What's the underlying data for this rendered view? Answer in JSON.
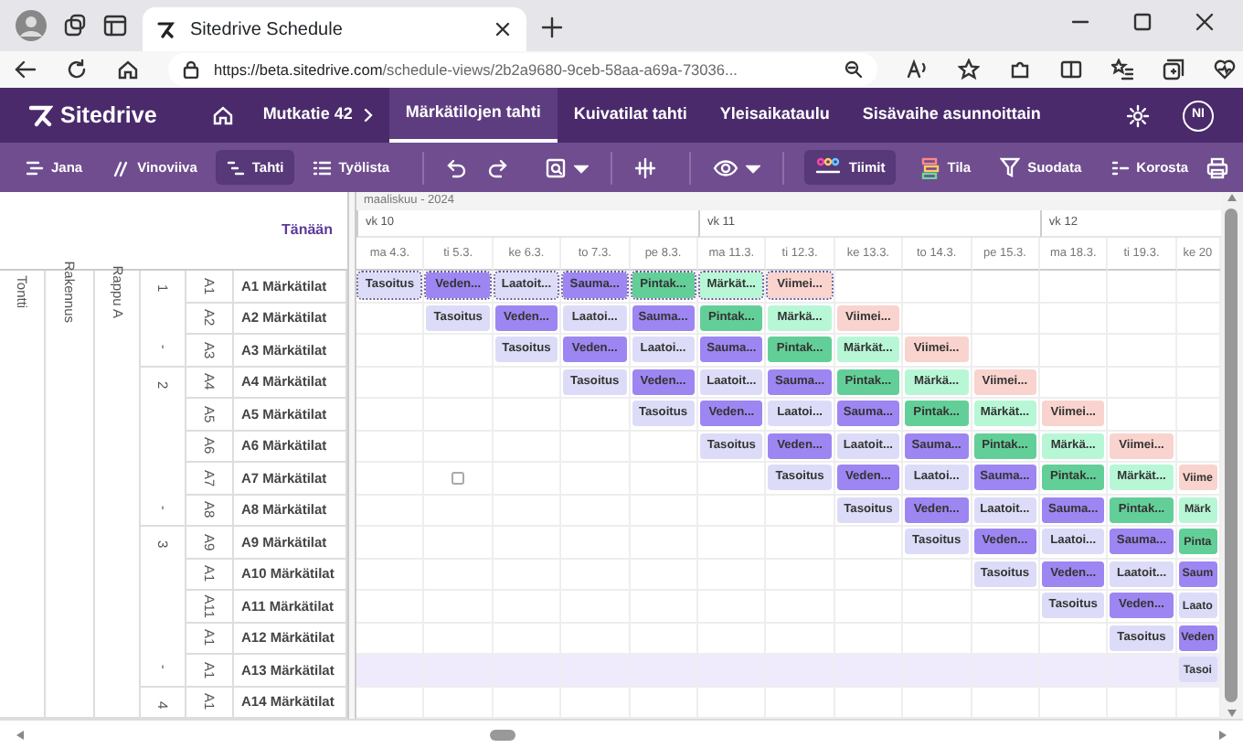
{
  "browser": {
    "tab_title": "Sitedrive Schedule",
    "url_host": "https://beta.sitedrive.com",
    "url_path": "/schedule-views/2b2a9680-9ceb-58aa-a69a-73036..."
  },
  "app": {
    "logo": "Sitedrive",
    "project": "Mutkatie 42",
    "avatar": "NI",
    "views": [
      {
        "label": "Märkätilojen tahti",
        "selected": true
      },
      {
        "label": "Kuivatilat tahti",
        "selected": false
      },
      {
        "label": "Yleisaikataulu",
        "selected": false
      },
      {
        "label": "Sisävaihe asunnoittain",
        "selected": false
      }
    ]
  },
  "toolbar": {
    "modes": [
      {
        "label": "Jana",
        "kind": "jana",
        "selected": false
      },
      {
        "label": "Vinoviiva",
        "kind": "vino",
        "selected": false
      },
      {
        "label": "Tahti",
        "kind": "tahti",
        "selected": true
      },
      {
        "label": "Työlista",
        "kind": "list",
        "selected": false
      }
    ],
    "teams": {
      "label": "Tiimit",
      "selected": true
    },
    "state": {
      "label": "Tila"
    },
    "filter": {
      "label": "Suodata"
    },
    "highlight": {
      "label": "Korosta"
    }
  },
  "schedule": {
    "today": "Tänään",
    "month": "maaliskuu - 2024",
    "weeks": [
      {
        "label": "vk 10",
        "days": [
          {
            "label": "ma 4.3."
          },
          {
            "label": "ti 5.3."
          },
          {
            "label": "ke 6.3."
          },
          {
            "label": "to 7.3."
          },
          {
            "label": "pe 8.3."
          }
        ]
      },
      {
        "label": "vk 11",
        "days": [
          {
            "label": "ma 11.3."
          },
          {
            "label": "ti 12.3."
          },
          {
            "label": "ke 13.3."
          },
          {
            "label": "to 14.3."
          },
          {
            "label": "pe 15.3."
          }
        ]
      },
      {
        "label": "vk 12",
        "days": [
          {
            "label": "ma 18.3."
          },
          {
            "label": "ti 19.3."
          },
          {
            "label": "ke 20"
          }
        ]
      }
    ],
    "site": "Tontti",
    "building": "Rakennus",
    "staircase": "Rappu A",
    "floors": [
      {
        "label": "1",
        "mark": "-",
        "rooms": [
          {
            "code": "A1",
            "name": "A1 Märkätilat",
            "highlighted": false,
            "cells": [
              {
                "kind": "task",
                "label": "Tasoitus",
                "color": "#dcdcf8",
                "selected": true
              },
              {
                "kind": "task",
                "label": "Veden...",
                "color": "#9d86f2",
                "selected": true
              },
              {
                "kind": "task",
                "label": "Laatoit...",
                "color": "#dcdcf8",
                "selected": true
              },
              {
                "kind": "task",
                "label": "Sauma...",
                "color": "#9d86f2",
                "selected": true
              },
              {
                "kind": "task",
                "label": "Pintak...",
                "color": "#63cf98",
                "selected": true
              },
              {
                "kind": "task",
                "label": "Märkät...",
                "color": "#b7f7d6",
                "selected": true
              },
              {
                "kind": "task",
                "label": "Viimei...",
                "color": "#f9d3cd",
                "selected": true
              }
            ]
          },
          {
            "code": "A2",
            "name": "A2 Märkätilat",
            "highlighted": false,
            "cells": [
              {
                "kind": "empty"
              },
              {
                "kind": "task",
                "label": "Tasoitus",
                "color": "#dcdcf8",
                "selected": false
              },
              {
                "kind": "task",
                "label": "Veden...",
                "color": "#9d86f2",
                "selected": false
              },
              {
                "kind": "task",
                "label": "Laatoi...",
                "color": "#dcdcf8",
                "selected": false
              },
              {
                "kind": "task",
                "label": "Sauma...",
                "color": "#9d86f2",
                "selected": false
              },
              {
                "kind": "task",
                "label": "Pintak...",
                "color": "#63cf98",
                "selected": false
              },
              {
                "kind": "task",
                "label": "Märkä...",
                "color": "#b7f7d6",
                "selected": false
              },
              {
                "kind": "task",
                "label": "Viimei...",
                "color": "#f9d3cd",
                "selected": false
              }
            ]
          },
          {
            "code": "A3",
            "name": "A3 Märkätilat",
            "highlighted": false,
            "cells": [
              {
                "kind": "empty"
              },
              {
                "kind": "empty"
              },
              {
                "kind": "task",
                "label": "Tasoitus",
                "color": "#dcdcf8",
                "selected": false
              },
              {
                "kind": "task",
                "label": "Veden...",
                "color": "#9d86f2",
                "selected": false
              },
              {
                "kind": "task",
                "label": "Laatoi...",
                "color": "#dcdcf8",
                "selected": false
              },
              {
                "kind": "task",
                "label": "Sauma...",
                "color": "#9d86f2",
                "selected": false
              },
              {
                "kind": "task",
                "label": "Pintak...",
                "color": "#63cf98",
                "selected": false
              },
              {
                "kind": "task",
                "label": "Märkät...",
                "color": "#b7f7d6",
                "selected": false
              },
              {
                "kind": "task",
                "label": "Viimei...",
                "color": "#f9d3cd",
                "selected": false
              }
            ]
          }
        ]
      },
      {
        "label": "2",
        "mark": "-",
        "rooms": [
          {
            "code": "A4",
            "name": "A4 Märkätilat",
            "highlighted": false,
            "cells": [
              {
                "kind": "empty"
              },
              {
                "kind": "empty"
              },
              {
                "kind": "empty"
              },
              {
                "kind": "task",
                "label": "Tasoitus",
                "color": "#dcdcf8",
                "selected": false
              },
              {
                "kind": "task",
                "label": "Veden...",
                "color": "#9d86f2",
                "selected": false
              },
              {
                "kind": "task",
                "label": "Laatoit...",
                "color": "#dcdcf8",
                "selected": false
              },
              {
                "kind": "task",
                "label": "Sauma...",
                "color": "#9d86f2",
                "selected": false
              },
              {
                "kind": "task",
                "label": "Pintak...",
                "color": "#63cf98",
                "selected": false
              },
              {
                "kind": "task",
                "label": "Märkä...",
                "color": "#b7f7d6",
                "selected": false
              },
              {
                "kind": "task",
                "label": "Viimei...",
                "color": "#f9d3cd",
                "selected": false
              }
            ]
          },
          {
            "code": "A5",
            "name": "A5 Märkätilat",
            "highlighted": false,
            "cells": [
              {
                "kind": "empty"
              },
              {
                "kind": "empty"
              },
              {
                "kind": "empty"
              },
              {
                "kind": "empty"
              },
              {
                "kind": "task",
                "label": "Tasoitus",
                "color": "#dcdcf8",
                "selected": false
              },
              {
                "kind": "task",
                "label": "Veden...",
                "color": "#9d86f2",
                "selected": false
              },
              {
                "kind": "task",
                "label": "Laatoi...",
                "color": "#dcdcf8",
                "selected": false
              },
              {
                "kind": "task",
                "label": "Sauma...",
                "color": "#9d86f2",
                "selected": false
              },
              {
                "kind": "task",
                "label": "Pintak...",
                "color": "#63cf98",
                "selected": false
              },
              {
                "kind": "task",
                "label": "Märkät...",
                "color": "#b7f7d6",
                "selected": false
              },
              {
                "kind": "task",
                "label": "Viimei...",
                "color": "#f9d3cd",
                "selected": false
              }
            ]
          },
          {
            "code": "A6",
            "name": "A6 Märkätilat",
            "highlighted": false,
            "cells": [
              {
                "kind": "empty"
              },
              {
                "kind": "empty"
              },
              {
                "kind": "empty"
              },
              {
                "kind": "empty"
              },
              {
                "kind": "empty"
              },
              {
                "kind": "task",
                "label": "Tasoitus",
                "color": "#dcdcf8",
                "selected": false
              },
              {
                "kind": "task",
                "label": "Veden...",
                "color": "#9d86f2",
                "selected": false
              },
              {
                "kind": "task",
                "label": "Laatoit...",
                "color": "#dcdcf8",
                "selected": false
              },
              {
                "kind": "task",
                "label": "Sauma...",
                "color": "#9d86f2",
                "selected": false
              },
              {
                "kind": "task",
                "label": "Pintak...",
                "color": "#63cf98",
                "selected": false
              },
              {
                "kind": "task",
                "label": "Märkä...",
                "color": "#b7f7d6",
                "selected": false
              },
              {
                "kind": "task",
                "label": "Viimei...",
                "color": "#f9d3cd",
                "selected": false
              }
            ]
          },
          {
            "code": "A7",
            "name": "A7 Märkätilat",
            "highlighted": false,
            "cells": [
              {
                "kind": "empty"
              },
              {
                "kind": "marker"
              },
              {
                "kind": "empty"
              },
              {
                "kind": "empty"
              },
              {
                "kind": "empty"
              },
              {
                "kind": "empty"
              },
              {
                "kind": "task",
                "label": "Tasoitus",
                "color": "#dcdcf8",
                "selected": false
              },
              {
                "kind": "task",
                "label": "Veden...",
                "color": "#9d86f2",
                "selected": false
              },
              {
                "kind": "task",
                "label": "Laatoi...",
                "color": "#dcdcf8",
                "selected": false
              },
              {
                "kind": "task",
                "label": "Sauma...",
                "color": "#9d86f2",
                "selected": false
              },
              {
                "kind": "task",
                "label": "Pintak...",
                "color": "#63cf98",
                "selected": false
              },
              {
                "kind": "task",
                "label": "Märkät...",
                "color": "#b7f7d6",
                "selected": false
              },
              {
                "kind": "task",
                "label": "Viime",
                "color": "#f9d3cd",
                "selected": false
              }
            ]
          },
          {
            "code": "A8",
            "name": "A8 Märkätilat",
            "highlighted": false,
            "cells": [
              {
                "kind": "empty"
              },
              {
                "kind": "empty"
              },
              {
                "kind": "empty"
              },
              {
                "kind": "empty"
              },
              {
                "kind": "empty"
              },
              {
                "kind": "empty"
              },
              {
                "kind": "empty"
              },
              {
                "kind": "task",
                "label": "Tasoitus",
                "color": "#dcdcf8",
                "selected": false
              },
              {
                "kind": "task",
                "label": "Veden...",
                "color": "#9d86f2",
                "selected": false
              },
              {
                "kind": "task",
                "label": "Laatoit...",
                "color": "#dcdcf8",
                "selected": false
              },
              {
                "kind": "task",
                "label": "Sauma...",
                "color": "#9d86f2",
                "selected": false
              },
              {
                "kind": "task",
                "label": "Pintak...",
                "color": "#63cf98",
                "selected": false
              },
              {
                "kind": "task",
                "label": "Märk",
                "color": "#b7f7d6",
                "selected": false
              }
            ]
          }
        ]
      },
      {
        "label": "3",
        "mark": "-",
        "rooms": [
          {
            "code": "A9",
            "name": "A9 Märkätilat",
            "highlighted": false,
            "cells": [
              {
                "kind": "empty"
              },
              {
                "kind": "empty"
              },
              {
                "kind": "empty"
              },
              {
                "kind": "empty"
              },
              {
                "kind": "empty"
              },
              {
                "kind": "empty"
              },
              {
                "kind": "empty"
              },
              {
                "kind": "empty"
              },
              {
                "kind": "task",
                "label": "Tasoitus",
                "color": "#dcdcf8",
                "selected": false
              },
              {
                "kind": "task",
                "label": "Veden...",
                "color": "#9d86f2",
                "selected": false
              },
              {
                "kind": "task",
                "label": "Laatoi...",
                "color": "#dcdcf8",
                "selected": false
              },
              {
                "kind": "task",
                "label": "Sauma...",
                "color": "#9d86f2",
                "selected": false
              },
              {
                "kind": "task",
                "label": "Pinta",
                "color": "#63cf98",
                "selected": false
              }
            ]
          },
          {
            "code": "A1",
            "name": "A10 Märkätilat",
            "highlighted": false,
            "cells": [
              {
                "kind": "empty"
              },
              {
                "kind": "empty"
              },
              {
                "kind": "empty"
              },
              {
                "kind": "empty"
              },
              {
                "kind": "empty"
              },
              {
                "kind": "empty"
              },
              {
                "kind": "empty"
              },
              {
                "kind": "empty"
              },
              {
                "kind": "empty"
              },
              {
                "kind": "task",
                "label": "Tasoitus",
                "color": "#dcdcf8",
                "selected": false
              },
              {
                "kind": "task",
                "label": "Veden...",
                "color": "#9d86f2",
                "selected": false
              },
              {
                "kind": "task",
                "label": "Laatoit...",
                "color": "#dcdcf8",
                "selected": false
              },
              {
                "kind": "task",
                "label": "Saum",
                "color": "#9d86f2",
                "selected": false
              }
            ]
          },
          {
            "code": "A11",
            "name": "A11 Märkätilat",
            "highlighted": false,
            "cells": [
              {
                "kind": "empty"
              },
              {
                "kind": "empty"
              },
              {
                "kind": "empty"
              },
              {
                "kind": "empty"
              },
              {
                "kind": "empty"
              },
              {
                "kind": "empty"
              },
              {
                "kind": "empty"
              },
              {
                "kind": "empty"
              },
              {
                "kind": "empty"
              },
              {
                "kind": "empty"
              },
              {
                "kind": "task",
                "label": "Tasoitus",
                "color": "#dcdcf8",
                "selected": false
              },
              {
                "kind": "task",
                "label": "Veden...",
                "color": "#9d86f2",
                "selected": false
              },
              {
                "kind": "task",
                "label": "Laato",
                "color": "#dcdcf8",
                "selected": false
              }
            ]
          },
          {
            "code": "A1",
            "name": "A12 Märkätilat",
            "highlighted": false,
            "cells": [
              {
                "kind": "empty"
              },
              {
                "kind": "empty"
              },
              {
                "kind": "empty"
              },
              {
                "kind": "empty"
              },
              {
                "kind": "empty"
              },
              {
                "kind": "empty"
              },
              {
                "kind": "empty"
              },
              {
                "kind": "empty"
              },
              {
                "kind": "empty"
              },
              {
                "kind": "empty"
              },
              {
                "kind": "empty"
              },
              {
                "kind": "task",
                "label": "Tasoitus",
                "color": "#dcdcf8",
                "selected": false
              },
              {
                "kind": "task",
                "label": "Veden",
                "color": "#9d86f2",
                "selected": false
              }
            ]
          },
          {
            "code": "A1",
            "name": "A13 Märkätilat",
            "highlighted": true,
            "cells": [
              {
                "kind": "empty"
              },
              {
                "kind": "empty"
              },
              {
                "kind": "empty"
              },
              {
                "kind": "empty"
              },
              {
                "kind": "empty"
              },
              {
                "kind": "empty"
              },
              {
                "kind": "empty"
              },
              {
                "kind": "empty"
              },
              {
                "kind": "empty"
              },
              {
                "kind": "empty"
              },
              {
                "kind": "empty"
              },
              {
                "kind": "empty"
              },
              {
                "kind": "task",
                "label": "Tasoi",
                "color": "#dcdcf8",
                "selected": false
              }
            ]
          }
        ]
      },
      {
        "label": "4",
        "rooms": [
          {
            "code": "A1",
            "name": "A14 Märkätilat",
            "highlighted": false
          }
        ]
      }
    ]
  }
}
